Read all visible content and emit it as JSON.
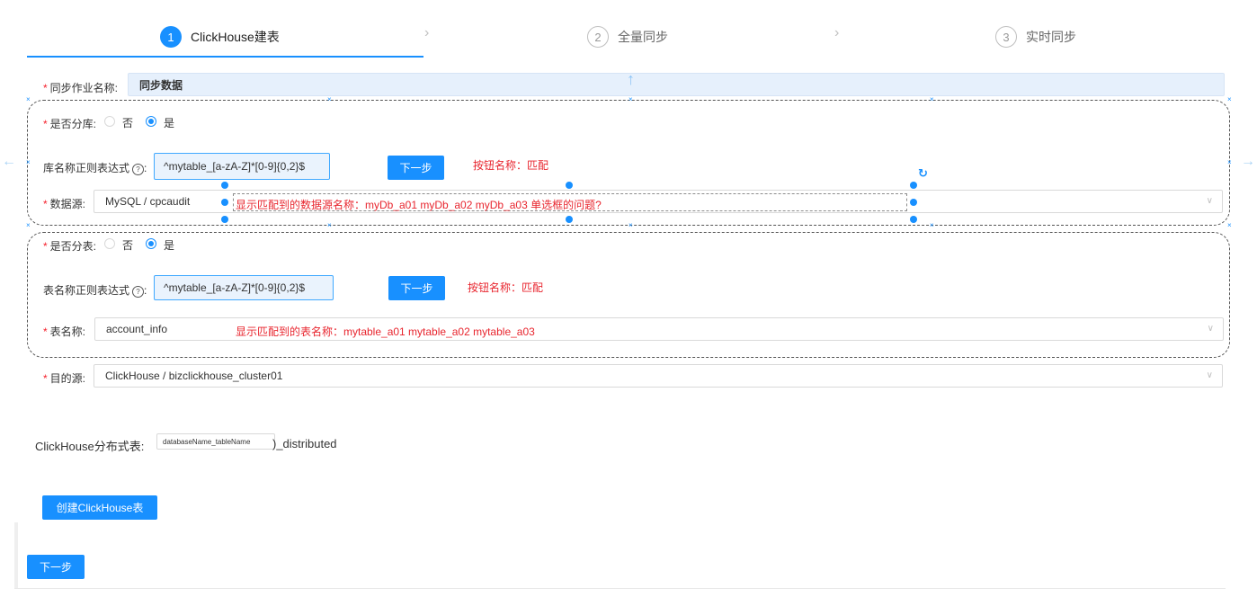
{
  "steps": [
    {
      "num": "1",
      "label": "ClickHouse建表"
    },
    {
      "num": "2",
      "label": "全量同步"
    },
    {
      "num": "3",
      "label": "实时同步"
    }
  ],
  "form": {
    "job_name": {
      "label": "同步作业名称:",
      "value": "同步数据"
    },
    "shard_db": {
      "label": "是否分库:",
      "no": "否",
      "yes": "是",
      "selected": "是"
    },
    "db_regex": {
      "label": "库名称正则表达式",
      "value": "^mytable_[a-zA-Z]*[0-9]{0,2}$",
      "button": "下一步",
      "note": "按钮名称：匹配"
    },
    "datasource": {
      "label": "数据源:",
      "value": "MySQL / cpcaudit",
      "note": "显示匹配到的数据源名称：myDb_a01 myDb_a02 myDb_a03      单选框的问题?"
    },
    "shard_table": {
      "label": "是否分表:",
      "no": "否",
      "yes": "是",
      "selected": "是"
    },
    "table_regex": {
      "label": "表名称正则表达式",
      "value": "^mytable_[a-zA-Z]*[0-9]{0,2}$",
      "button": "下一步",
      "note": "按钮名称：匹配"
    },
    "table_name": {
      "label": "表名称:",
      "value": "account_info",
      "note": "显示匹配到的表名称：mytable_a01 mytable_a02 mytable_a03"
    },
    "target": {
      "label": "目的源:",
      "value": "ClickHouse / bizclickhouse_cluster01"
    },
    "distributed": {
      "label": "ClickHouse分布式表:",
      "value": "databaseName_tableName",
      "suffix": ")_distributed"
    }
  },
  "buttons": {
    "create": "创建ClickHouse表",
    "next": "下一步"
  },
  "colors": {
    "primary": "#1890ff",
    "annotation": "#e8252e"
  }
}
